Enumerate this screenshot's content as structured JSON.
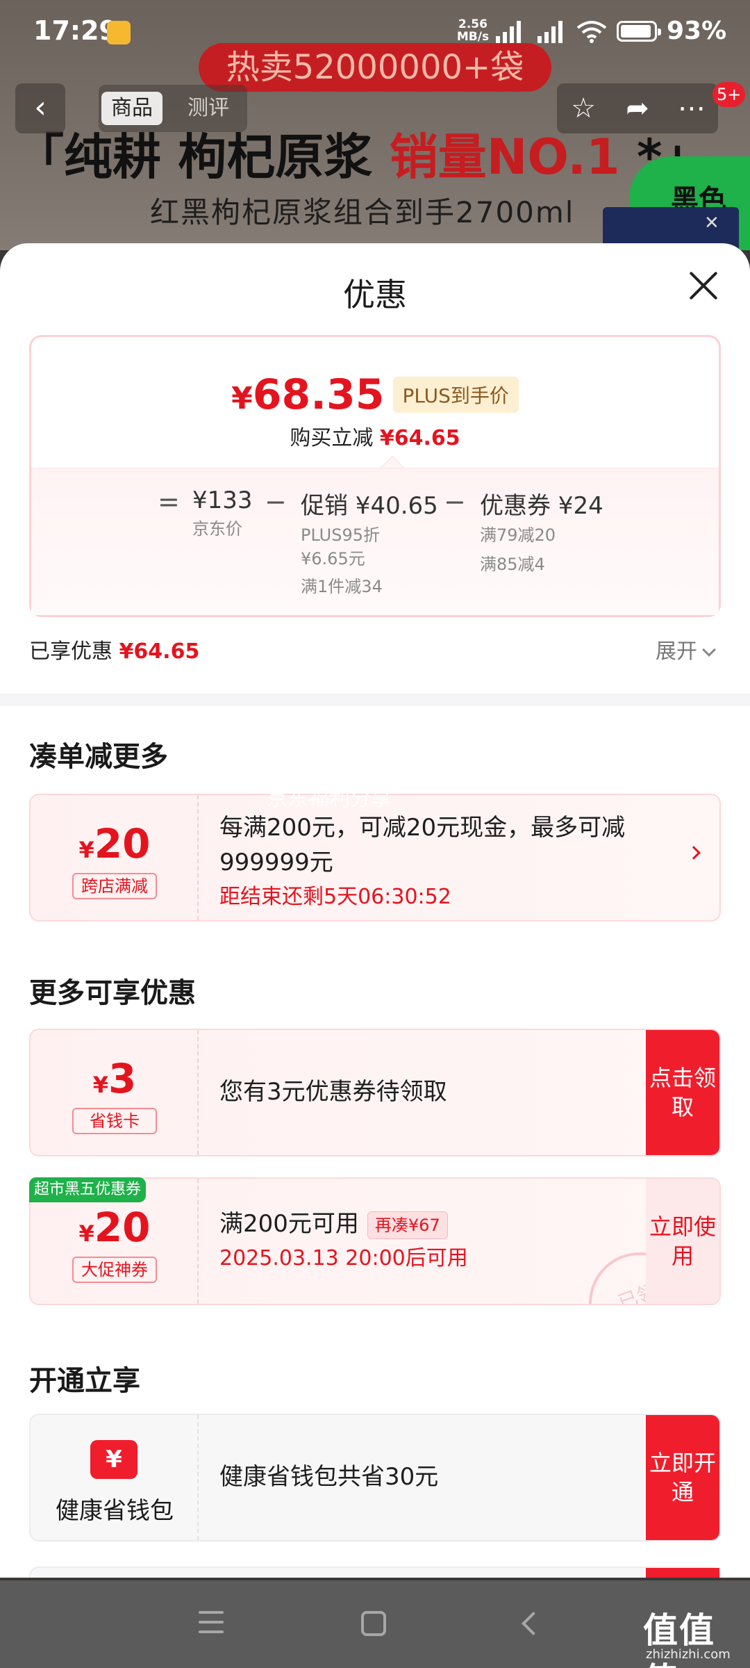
{
  "status": {
    "time": "17:29",
    "net_speed": "2.56",
    "net_unit": "MB/s",
    "battery": "93%"
  },
  "product": {
    "hot_banner": "热卖52000000+袋",
    "headline_prefix": "「纯耕 枸杞原浆 ",
    "headline_red": "销量NO.1",
    "headline_suffix": " *」",
    "subline": "红黑枸杞原浆组合到手2700ml",
    "green_tag": "黑色"
  },
  "topnav": {
    "tab_goods": "商品",
    "tab_review": "测评",
    "notif_count": "5+"
  },
  "sheet": {
    "title": "优惠",
    "final_price_yen": "¥",
    "final_price": "68.35",
    "plus_label": "PLUS到手价",
    "instant_label": "购买立减",
    "instant_value": "¥64.65",
    "breakdown": {
      "eq": "=",
      "minus": "−",
      "jd_amount": "¥133",
      "jd_label": "京东价",
      "promo_amount": "促销 ¥40.65",
      "promo_sub1": "PLUS95折",
      "promo_sub2": "¥6.65元",
      "promo_sub3": "满1件减34",
      "coupon_amount": "优惠券 ¥24",
      "coupon_sub1": "满79减20",
      "coupon_sub2": "满85减4"
    },
    "enjoyed_label": "已享优惠",
    "enjoyed_value": "¥64.65",
    "expand_label": "展开"
  },
  "sections": {
    "more_orders": "凑单减更多",
    "more_discounts": "更多可享优惠",
    "open_enjoy": "开通立享"
  },
  "coupons": {
    "cross_store": {
      "yen": "¥",
      "amount": "20",
      "tag": "跨店满减",
      "text": "每满200元，可减20元现金，最多可减999999元",
      "countdown": "距结束还剩5天06:30:52"
    },
    "savings_card": {
      "yen": "¥",
      "amount": "3",
      "tag": "省钱卡",
      "text": "您有3元优惠券待领取",
      "button": "点击领取"
    },
    "promo_coupon": {
      "badge": "超市黑五优惠券",
      "yen": "¥",
      "amount": "20",
      "tag": "大促神券",
      "text": "满200元可用",
      "again": "再凑¥67",
      "time": "2025.03.13 20:00后可用",
      "button": "立即使用",
      "stamp": "已领"
    },
    "wallet": {
      "icon": "¥",
      "name": "健康省钱包",
      "text": "健康省钱包共省30元",
      "button": "立即开通"
    }
  },
  "watermarks": {
    "jd_faint": "京东福利分享",
    "site": "值值值",
    "site_url": "zhizhizhi.com"
  },
  "colors": {
    "accent": "#e4141f",
    "button": "#f01e2d",
    "green": "#1fb14a",
    "plus_tag_bg": "#fdefd2"
  }
}
